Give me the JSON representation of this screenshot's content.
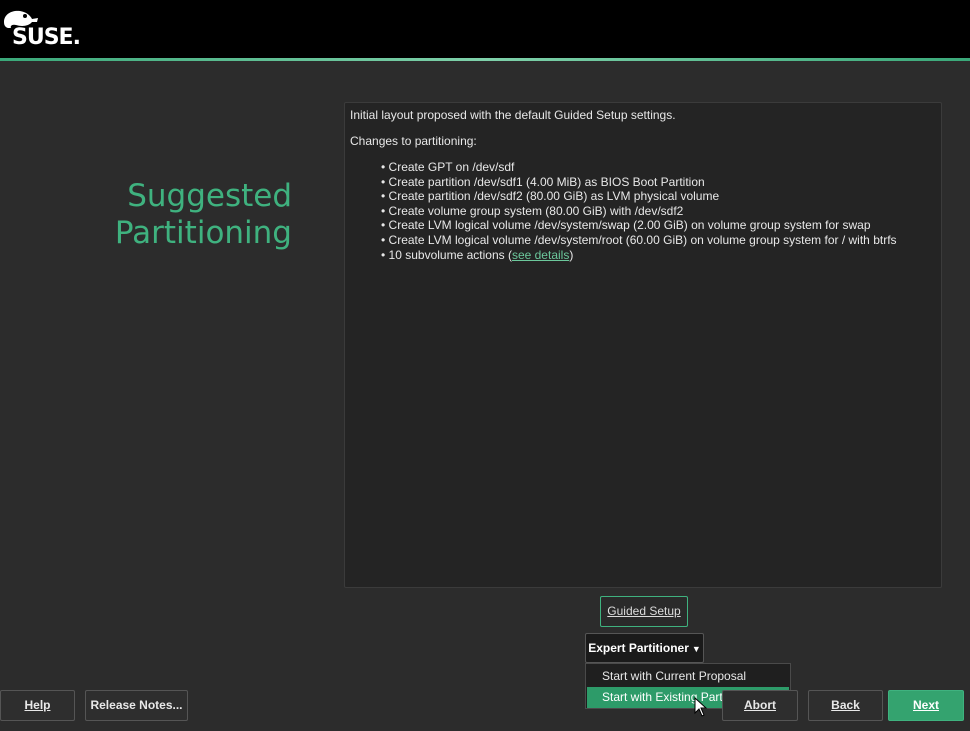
{
  "brand": {
    "logo_text": "SUSE."
  },
  "page": {
    "title_line1": "Suggested",
    "title_line2": "Partitioning"
  },
  "summary": {
    "intro": "Initial layout proposed with the default Guided Setup settings.",
    "changes_heading": "Changes to partitioning:",
    "items": [
      "Create GPT on /dev/sdf",
      "Create partition /dev/sdf1 (4.00 MiB) as BIOS Boot Partition",
      "Create partition /dev/sdf2 (80.00 GiB) as LVM physical volume",
      "Create volume group system (80.00 GiB) with /dev/sdf2",
      "Create LVM logical volume /dev/system/swap (2.00 GiB) on volume group system for swap",
      "Create LVM logical volume /dev/system/root (60.00 GiB) on volume group system for / with btrfs"
    ],
    "subvolume_prefix": "10 subvolume actions (",
    "see_details": "see details",
    "subvolume_suffix": ")"
  },
  "buttons": {
    "guided_setup": "Guided Setup",
    "expert_partitioner": "Expert Partitioner",
    "help": "Help",
    "release_notes": "Release Notes...",
    "abort": "Abort",
    "back": "Back",
    "next": "Next"
  },
  "expert_menu": {
    "items": [
      "Start with Current Proposal",
      "Start with Existing Partitions"
    ],
    "highlighted": "Start with Existing Partitions"
  },
  "colors": {
    "accent": "#3fb27f",
    "highlight": "#2d9b69",
    "background": "#2c2c2c"
  }
}
